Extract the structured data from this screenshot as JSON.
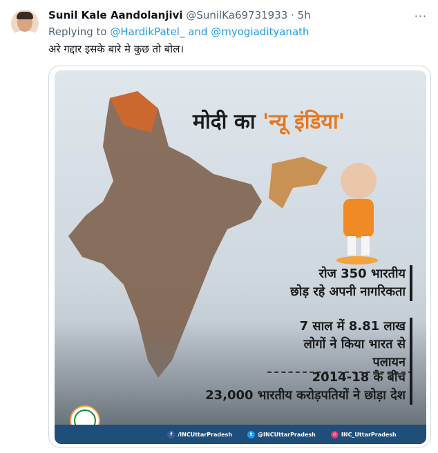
{
  "tweet": {
    "display_name": "Sunil Kale Aandolanjivi",
    "handle": "@SunilKa69731933",
    "separator": "·",
    "time": "5h",
    "more_label": "···",
    "replying_to_prefix": "Replying to",
    "mention_1": "@HardikPatel_",
    "mention_and": "and",
    "mention_2": "@myogiadityanath",
    "text": "अरे गद्दार इसके बारे मे कुछ तो बोल।"
  },
  "poster": {
    "title_prefix": "मोदी का",
    "title_highlight": "'न्यू इंडिया'",
    "fact_1_line_1": "रोज 350 भारतीय",
    "fact_1_line_2": "छोड़ रहे अपनी नागरिकता",
    "fact_2_line_1": "7 साल में 8.81 लाख",
    "fact_2_line_2": "लोगों ने किया भारत से पलायन",
    "fact_3_line_1": "2014-18 के बीच",
    "fact_3_line_2": "23,000 भारतीय करोड़पतियों ने छोड़ा देश",
    "social_1": "/INCUttarPradesh",
    "social_2": "@INCUttarPradesh",
    "social_3": "INC_UttarPradesh"
  },
  "colors": {
    "accent_saffron": "#e8771e",
    "footer_blue": "#1f4e7a",
    "link_blue": "#1d9bf0",
    "muted_text": "#536471"
  }
}
